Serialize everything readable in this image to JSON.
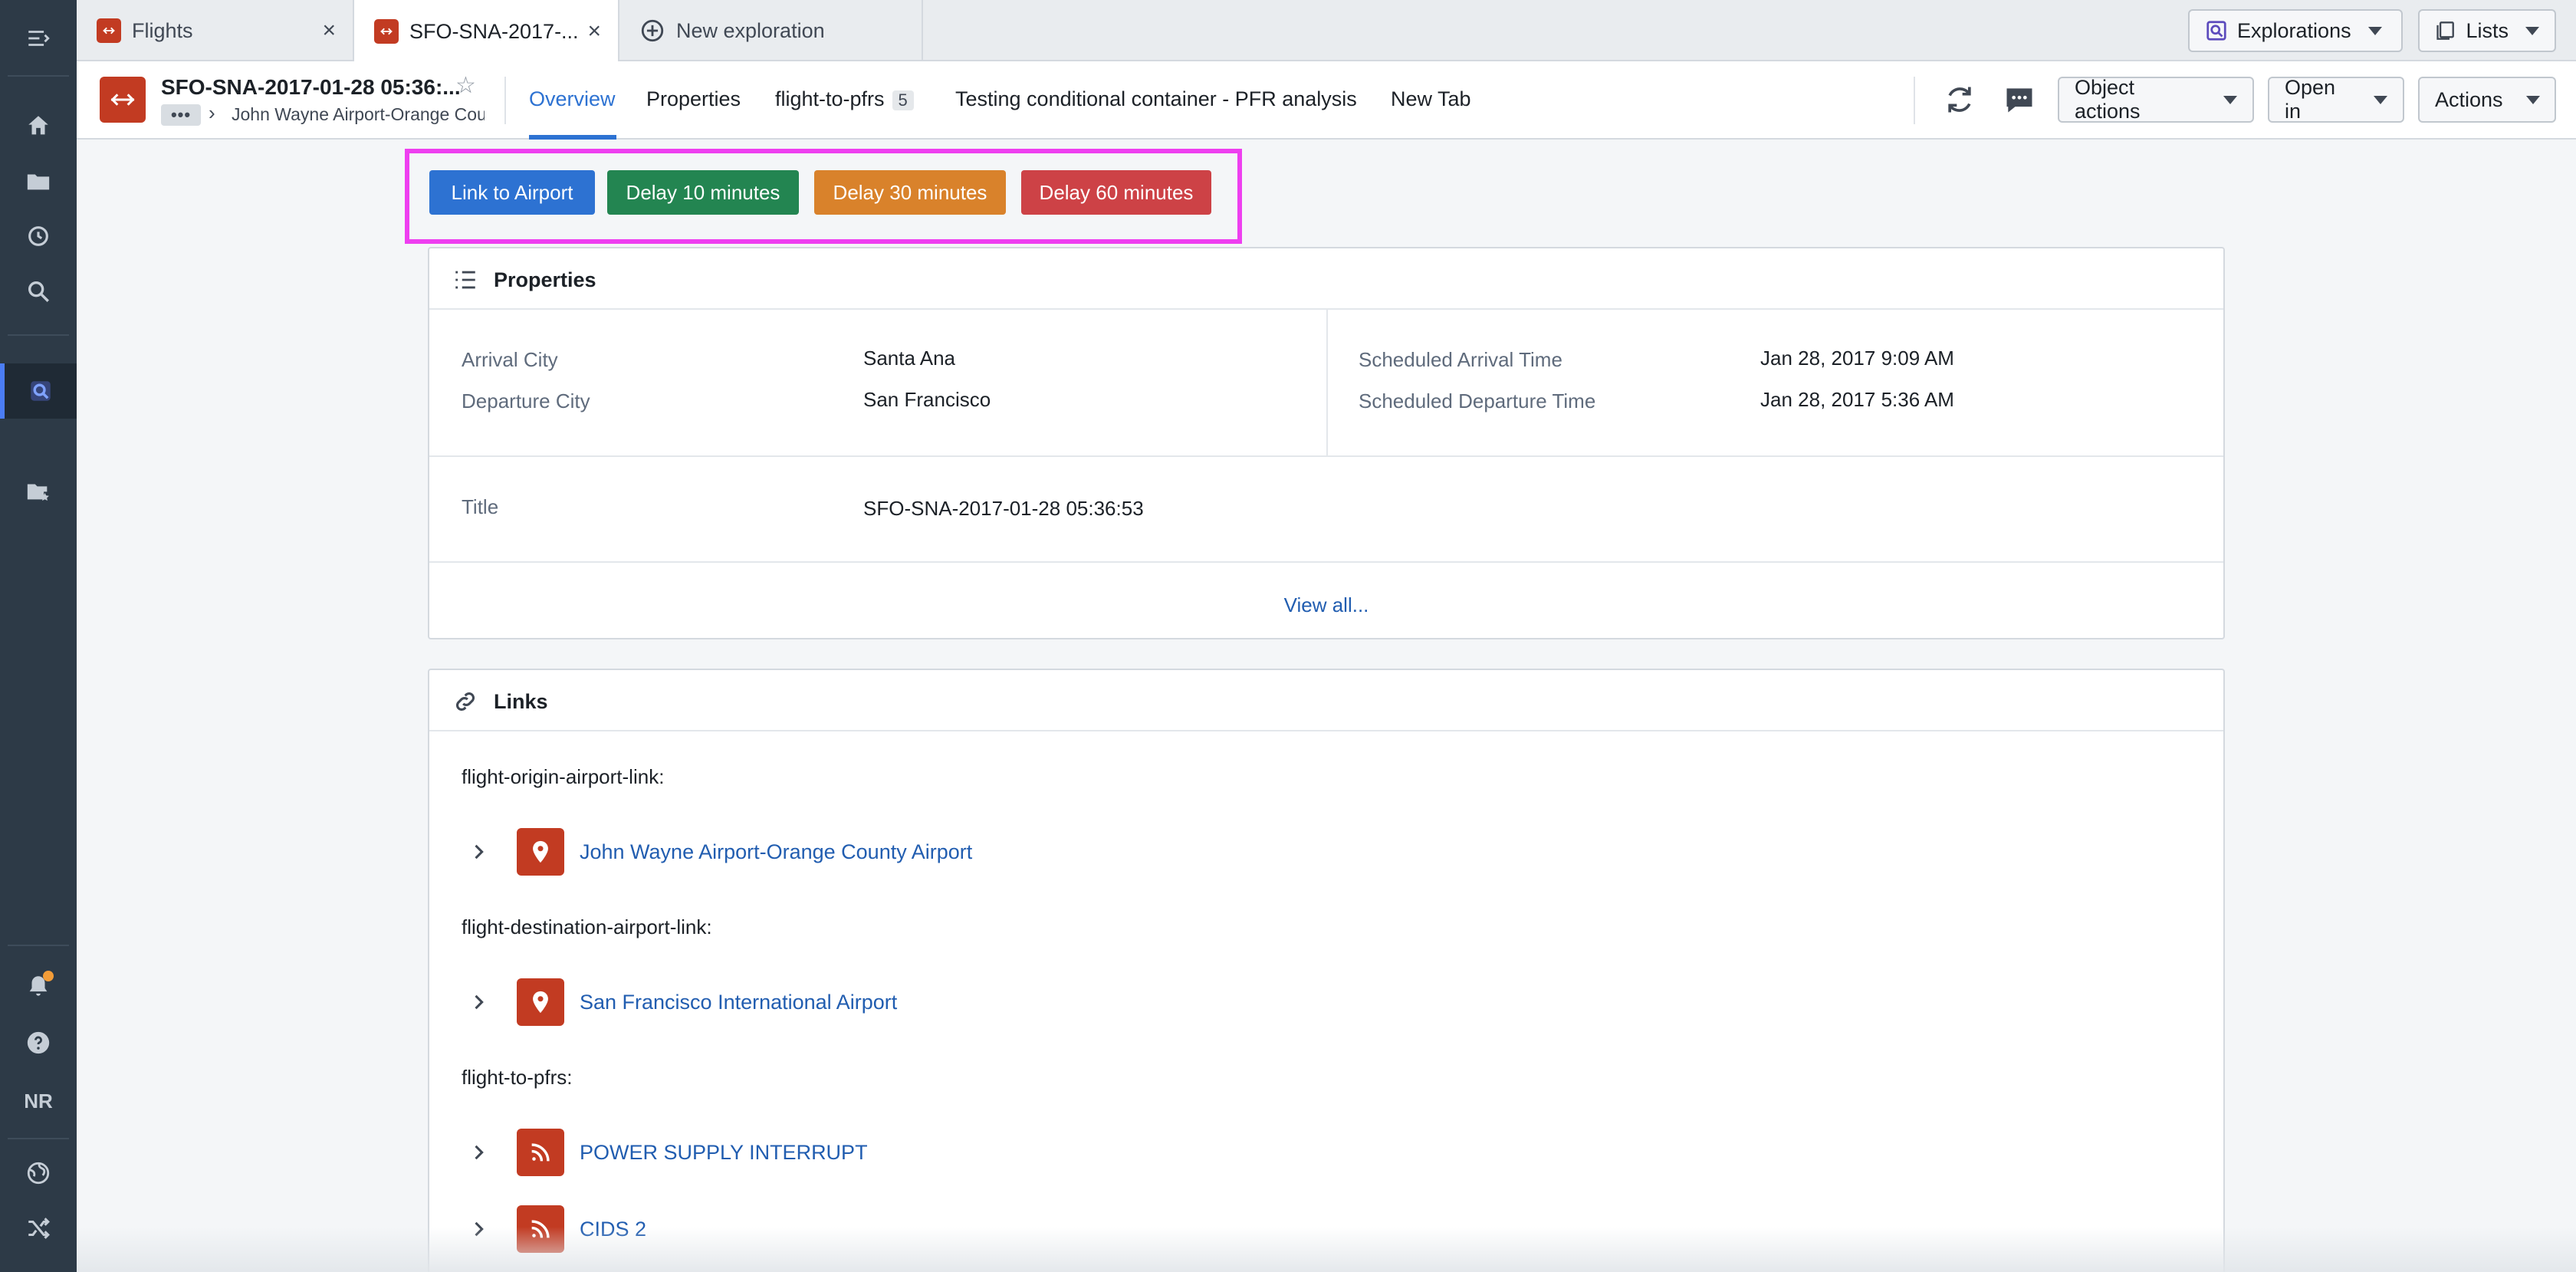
{
  "tabs": [
    {
      "label": "Flights"
    },
    {
      "label": "SFO-SNA-2017-..."
    },
    {
      "label": "New exploration"
    }
  ],
  "top_right": {
    "explorations": "Explorations",
    "lists": "Lists"
  },
  "rail": {
    "initials": "NR"
  },
  "header": {
    "title": "SFO-SNA-2017-01-28 05:36:...",
    "breadcrumb_more": "•••",
    "breadcrumb": "John Wayne Airport-Orange County Airport",
    "nav": [
      {
        "label": "Overview"
      },
      {
        "label": "Properties"
      },
      {
        "label": "flight-to-pfrs",
        "count": "5"
      },
      {
        "label": "Testing conditional container - PFR analysis"
      },
      {
        "label": "New Tab"
      }
    ],
    "object_actions": "Object actions",
    "open_in": "Open in",
    "actions": "Actions"
  },
  "action_buttons": [
    {
      "label": "Link to Airport",
      "color": "#2d72d2"
    },
    {
      "label": "Delay 10 minutes",
      "color": "#238551"
    },
    {
      "label": "Delay 30 minutes",
      "color": "#d9822b"
    },
    {
      "label": "Delay 60 minutes",
      "color": "#cd4246"
    }
  ],
  "properties": {
    "title": "Properties",
    "items": [
      {
        "label": "Arrival City",
        "value": "Santa Ana"
      },
      {
        "label": "Departure City",
        "value": "San Francisco"
      },
      {
        "label": "Scheduled Arrival Time",
        "value": "Jan 28, 2017 9:09 AM"
      },
      {
        "label": "Scheduled Departure Time",
        "value": "Jan 28, 2017 5:36 AM"
      },
      {
        "label": "Title",
        "value": "SFO-SNA-2017-01-28 05:36:53"
      }
    ],
    "view_all": "View all..."
  },
  "links": {
    "title": "Links",
    "groups": [
      {
        "label": "flight-origin-airport-link:",
        "items": [
          {
            "text": "John Wayne Airport-Orange County Airport",
            "icon": "map-pin-icon"
          }
        ]
      },
      {
        "label": "flight-destination-airport-link:",
        "items": [
          {
            "text": "San Francisco International Airport",
            "icon": "map-pin-icon"
          }
        ]
      },
      {
        "label": "flight-to-pfrs:",
        "items": [
          {
            "text": "POWER SUPPLY INTERRUPT",
            "icon": "feed-icon"
          },
          {
            "text": "CIDS 2",
            "icon": "feed-icon"
          }
        ]
      }
    ]
  }
}
